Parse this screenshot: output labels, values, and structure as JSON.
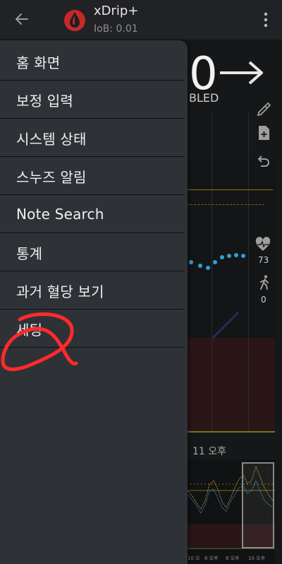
{
  "app_bar": {
    "title": "xDrip+",
    "subtitle": "IoB: 0.01",
    "icons": {
      "back": "arrow-left-icon",
      "app": "blood-drop-icon",
      "overflow": "more-vertical-icon"
    }
  },
  "drawer": {
    "items": [
      {
        "label": "홈 화면"
      },
      {
        "label": "보정 입력"
      },
      {
        "label": "시스템 상태"
      },
      {
        "label": "스누즈 알림"
      },
      {
        "label": "Note Search"
      },
      {
        "label": "통계"
      },
      {
        "label": "과거 혈당 보기"
      },
      {
        "label": "세팅"
      }
    ]
  },
  "background": {
    "glucose_value_fragment": "0",
    "status_fragment": "BLED",
    "heart_rate": "73",
    "steps": "0",
    "time_label": "11 오후",
    "x_ticks": [
      "10 오",
      "6 오후",
      "8 오후",
      "10 오후"
    ],
    "icons": [
      "pipette-icon",
      "add-note-icon",
      "undo-icon",
      "heart-rate-icon",
      "walking-person-icon"
    ]
  },
  "colors": {
    "drawer_bg": "#2e3136",
    "app_icon_red": "#c62828",
    "glucose_dot": "#2f9fd6",
    "target_line": "#8a7a1a",
    "high_zone": "#2a1517",
    "annotation_red": "#ff2a2a"
  }
}
